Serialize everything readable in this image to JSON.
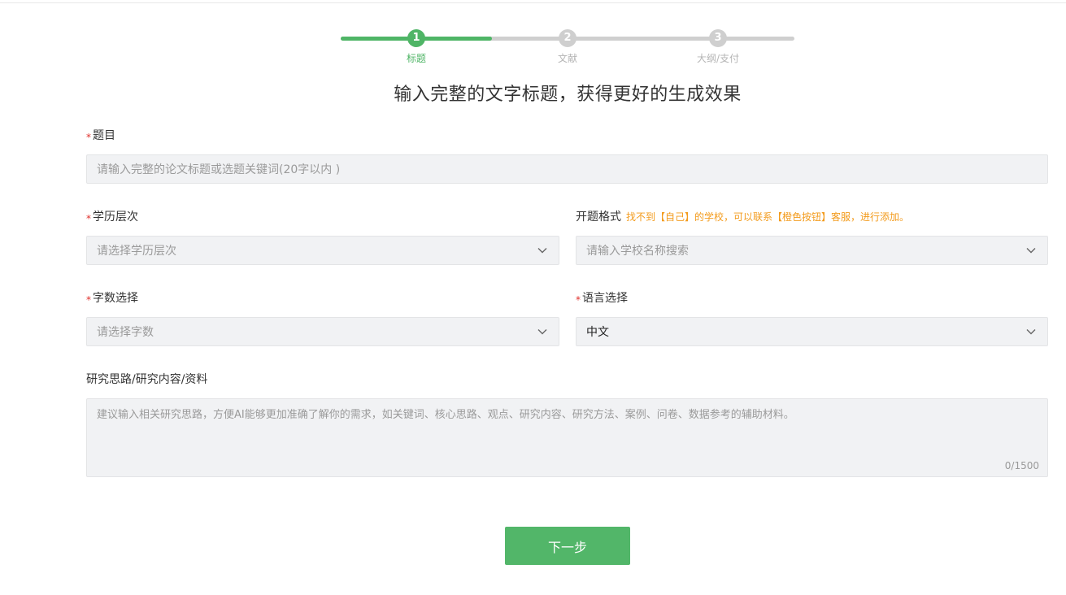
{
  "stepper": {
    "steps": [
      {
        "number": "1",
        "label": "标题"
      },
      {
        "number": "2",
        "label": "文献"
      },
      {
        "number": "3",
        "label": "大纲/支付"
      }
    ],
    "current_step": 1,
    "active_color": "#4fb566",
    "inactive_color": "#cfcfcf"
  },
  "headline": "输入完整的文字标题，获得更好的生成效果",
  "form": {
    "required_mark": "*",
    "title": {
      "label": "题目",
      "placeholder": "请输入完整的论文标题或选题关键词(20字以内 )"
    },
    "education": {
      "label": "学历层次",
      "placeholder": "请选择学历层次",
      "icon": "chevron-down-icon"
    },
    "proposal_format": {
      "label": "开题格式",
      "hint": "找不到【自己】的学校，可以联系【橙色按钮】客服，进行添加。",
      "placeholder": "请输入学校名称搜索",
      "icon": "chevron-down-icon",
      "hint_color": "#f39b1c"
    },
    "word_count": {
      "label": "字数选择",
      "placeholder": "请选择字数",
      "icon": "chevron-down-icon"
    },
    "language": {
      "label": "语言选择",
      "value": "中文",
      "icon": "chevron-down-icon"
    },
    "research": {
      "label": "研究思路/研究内容/资料",
      "placeholder": "建议输入相关研究思路，方便AI能够更加准确了解你的需求，如关键词、核心思路、观点、研究内容、研究方法、案例、问卷、数据参考的辅助材料。",
      "counter": "0/1500"
    }
  },
  "next_button": {
    "label": "下一步",
    "color": "#52b669"
  }
}
